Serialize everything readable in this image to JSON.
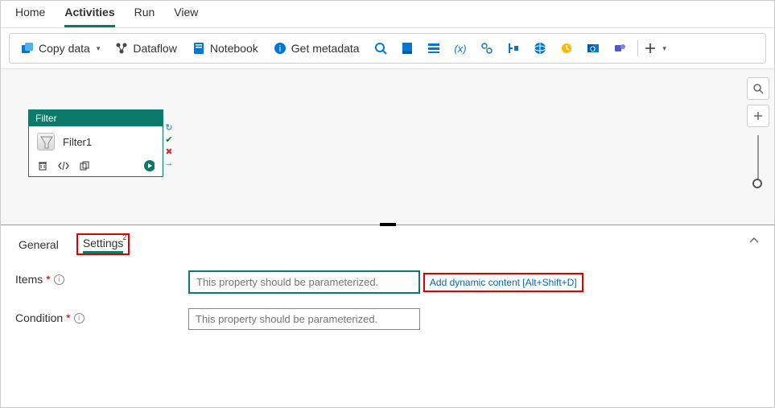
{
  "top_tabs": {
    "home": "Home",
    "activities": "Activities",
    "run": "Run",
    "view": "View"
  },
  "toolbar": {
    "copy_data": "Copy data",
    "dataflow": "Dataflow",
    "notebook": "Notebook",
    "get_metadata": "Get metadata"
  },
  "node": {
    "type": "Filter",
    "name": "Filter1"
  },
  "panel_tabs": {
    "general": "General",
    "settings": "Settings",
    "settings_count": "2"
  },
  "form": {
    "items_label": "Items",
    "condition_label": "Condition",
    "required_mark": "*",
    "items_placeholder": "This property should be parameterized.",
    "condition_placeholder": "This property should be parameterized.",
    "dynamic_link": "Add dynamic content [Alt+Shift+D]"
  },
  "colors": {
    "teal": "#0b7a6a",
    "red": "#d00000",
    "blue": "#0078d4"
  }
}
